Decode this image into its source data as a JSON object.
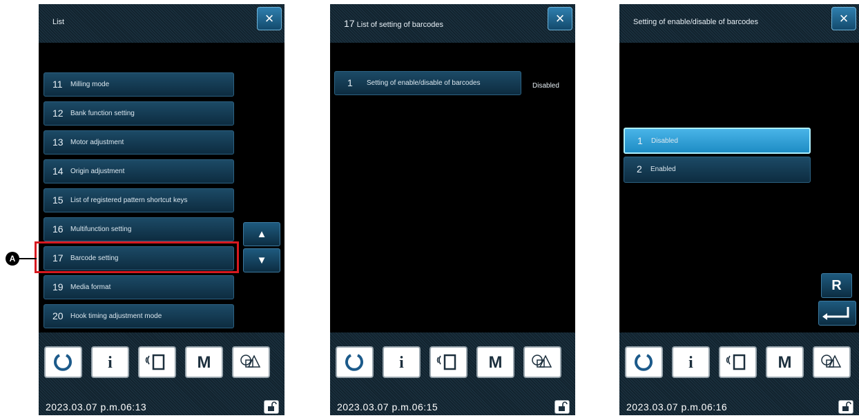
{
  "panel1": {
    "title": "List",
    "close_icon": "×",
    "items": [
      {
        "num": "11",
        "label": "Milling mode"
      },
      {
        "num": "12",
        "label": "Bank function setting"
      },
      {
        "num": "13",
        "label": "Motor adjustment"
      },
      {
        "num": "14",
        "label": "Origin adjustment"
      },
      {
        "num": "15",
        "label": "List of registered pattern shortcut keys"
      },
      {
        "num": "16",
        "label": "Multifunction setting"
      },
      {
        "num": "17",
        "label": "Barcode setting"
      },
      {
        "num": "19",
        "label": "Media format"
      },
      {
        "num": "20",
        "label": "Hook timing adjustment mode"
      }
    ],
    "scroll_up": "▲",
    "scroll_down": "▼",
    "datetime": "2023.03.07 p.m.06:13",
    "callout_label": "A"
  },
  "panel2": {
    "title_num": "17",
    "title": "List of setting of barcodes",
    "close_icon": "×",
    "item": {
      "num": "1",
      "label": "Setting of enable/disable of barcodes",
      "value": "Disabled"
    },
    "datetime": "2023.03.07 p.m.06:15"
  },
  "panel3": {
    "title": "Setting of enable/disable of barcodes",
    "close_icon": "×",
    "options": [
      {
        "num": "1",
        "label": "Disabled",
        "selected": true
      },
      {
        "num": "2",
        "label": "Enabled",
        "selected": false
      }
    ],
    "reset_label": "R",
    "enter_icon": "enter-arrow-icon",
    "datetime": "2023.03.07 p.m.06:16"
  },
  "toolbar": {
    "icons": [
      "reset-icon",
      "info-icon",
      "communication-icon",
      "mode-icon",
      "pattern-shapes-icon"
    ],
    "info_glyph": "i",
    "mode_glyph": "M"
  },
  "lock_icon": "unlock-icon",
  "colors": {
    "accent": "#1e8cc4",
    "selected": "#49b4e8",
    "callout": "#d71920",
    "background": "#000000"
  }
}
